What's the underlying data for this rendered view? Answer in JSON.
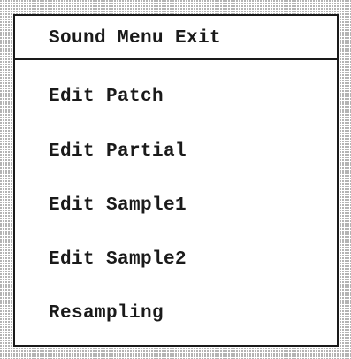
{
  "menu": {
    "title": "Sound Menu Exit",
    "items": [
      {
        "label": "Edit Patch"
      },
      {
        "label": "Edit Partial"
      },
      {
        "label": "Edit Sample1"
      },
      {
        "label": "Edit Sample2"
      },
      {
        "label": "Resampling"
      }
    ]
  },
  "colors": {
    "text": "#1a1a1a",
    "border": "#1a1a1a",
    "background": "#ffffff",
    "desktop_dither": "#6f6f6f"
  }
}
